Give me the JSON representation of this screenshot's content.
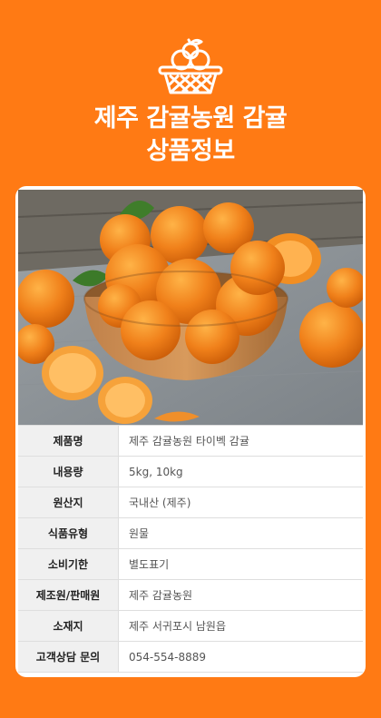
{
  "header": {
    "title_line1": "제주 감귤농원 감귤",
    "title_line2": "상품정보",
    "logo_icon": "tangerine-basket-icon"
  },
  "product_image": {
    "subject": "tangerines-in-wooden-bowl"
  },
  "info_table": {
    "rows": [
      {
        "label": "제품명",
        "value": "제주 감귤농원 타이벡 감귤"
      },
      {
        "label": "내용량",
        "value": "5kg, 10kg"
      },
      {
        "label": "원산지",
        "value": "국내산 (제주)"
      },
      {
        "label": "식품유형",
        "value": "원물"
      },
      {
        "label": "소비기한",
        "value": "별도표기"
      },
      {
        "label": "제조원/판매원",
        "value": "제주 감귤농원"
      },
      {
        "label": "소재지",
        "value": "제주 서귀포시 남원읍"
      },
      {
        "label": "고객상담 문의",
        "value": "054-554-8889"
      }
    ]
  },
  "colors": {
    "background": "#ff7a14",
    "card": "#ffffff",
    "label_cell": "#f0f0f0"
  }
}
